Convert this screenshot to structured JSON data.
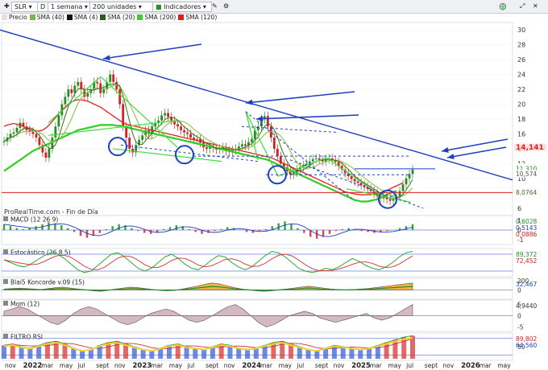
{
  "toolbar": {
    "symbol": "SLR",
    "timeframe_letter": "D",
    "period": "1 semana",
    "units": "200 unidades",
    "indicators": "Indicadores"
  },
  "legend": [
    {
      "label": "Precio",
      "color": "#e0e0e0"
    },
    {
      "label": "SMA (40)",
      "color": "#7ab648"
    },
    {
      "label": "SMA (4)",
      "color": "#111111"
    },
    {
      "label": "SMA (20)",
      "color": "#2e5e1a"
    },
    {
      "label": "SMA (200)",
      "color": "#3ecf2e"
    },
    {
      "label": "SMA (120)",
      "color": "#e02020"
    }
  ],
  "watermark": "ProRealTime.com - Fin de Día",
  "colors": {
    "price_up": "#2a8a2a",
    "price_down": "#cc2222",
    "sma4": "#1d1d1d",
    "sma20": "#3d6e1e",
    "sma40": "#8fbf3f",
    "sma120": "#e02020",
    "sma200": "#33cc22",
    "trend": "#1f3fbf"
  },
  "chart_data": [
    {
      "type": "line",
      "title": "SLR",
      "y_axis_ticks": [
        "30",
        "28",
        "26",
        "24",
        "22",
        "20",
        "18",
        "16",
        "14",
        "12",
        "10",
        "8",
        "6"
      ],
      "ylim": [
        5,
        31
      ],
      "x_axis_labels": [
        "nov",
        "2022",
        "mar",
        "may",
        "jul",
        "sept",
        "nov",
        "2023",
        "mar",
        "may",
        "jul",
        "sept",
        "nov",
        "2024",
        "mar",
        "may",
        "jul",
        "sept",
        "nov",
        "2025",
        "mar",
        "may",
        "jul",
        "sept",
        "nov",
        "2026",
        "mar",
        "may"
      ],
      "price_labels": [
        {
          "text": "14,141",
          "color": "#e02020"
        },
        {
          "text": "11,482",
          "color": "#999999"
        },
        {
          "text": "11,310",
          "color": "#2a8a2a"
        },
        {
          "text": "10,574",
          "color": "#555555"
        },
        {
          "text": "8,2716",
          "color": "#33cc22"
        },
        {
          "text": "8,0764",
          "color": "#3d6e1e"
        }
      ],
      "price_weekly": [
        15,
        15.5,
        16,
        16.2,
        16.8,
        17.5,
        17,
        16.5,
        16.3,
        16,
        15.5,
        14.5,
        13.5,
        12.8,
        14,
        15.5,
        17,
        18.5,
        20,
        21,
        22,
        21.5,
        22.5,
        23,
        22,
        21,
        21.5,
        22,
        23,
        22.8,
        21.5,
        22,
        23,
        24,
        23,
        22,
        20,
        17,
        15.5,
        14,
        13.5,
        14.5,
        15.2,
        15.8,
        16.5,
        16,
        17,
        17.5,
        17.8,
        18.5,
        18.8,
        18.3,
        17.8,
        17.3,
        17,
        16.5,
        16.2,
        16,
        15.5,
        15.2,
        15.3,
        14.8,
        14.2,
        14,
        14.3,
        14.1,
        13.9,
        14,
        14.2,
        13.7,
        13.6,
        13.8,
        14,
        14.3,
        14.6,
        14.4,
        14.9,
        15.3,
        16.5,
        17,
        18,
        18.4,
        17,
        15.5,
        14,
        13,
        12,
        11.5,
        11,
        10.5,
        10.8,
        11.2,
        11.5,
        11.8,
        12,
        12.3,
        12.6,
        12.7,
        12.5,
        12.3,
        12.6,
        12.7,
        12.4,
        12.2,
        11.7,
        11.2,
        10.7,
        10.3,
        9.9,
        9.6,
        9.4,
        9.1,
        8.9,
        8.6,
        8.3,
        8,
        7.6,
        7.3,
        7.5,
        7.2,
        7,
        7.2,
        7.6,
        8.3,
        9.2,
        10,
        10.6,
        11.2
      ],
      "sma120_weekly": [
        17,
        17.2,
        17.3,
        17.4,
        17.3,
        17.2,
        17,
        16.8,
        16.6,
        16.5,
        16.4,
        16.4,
        16.5,
        16.8,
        17.2,
        17.7,
        18.2,
        18.7,
        19.2,
        19.6,
        20,
        20.3,
        20.5,
        20.6,
        20.6,
        20.5,
        20.4,
        20.2,
        20,
        19.8,
        19.6,
        19.3,
        19,
        18.7,
        18.4,
        18.1,
        17.8,
        17.5,
        17.3,
        17.2,
        17.1,
        17,
        16.9,
        16.8,
        16.7,
        16.6,
        16.5,
        16.4,
        16.3,
        16.2,
        16.1,
        16,
        15.9,
        15.8,
        15.7,
        15.6,
        15.5,
        15.4,
        15.3,
        15.2,
        15.1,
        15,
        14.9,
        14.8,
        14.7,
        14.6,
        14.5,
        14.4,
        14.3,
        14.2,
        14.1,
        14,
        13.9,
        13.8,
        13.7,
        13.6,
        13.5,
        13.4,
        13.3,
        13.2,
        13.1,
        13,
        12.9,
        12.8,
        12.6,
        12.4,
        12.2,
        12,
        11.8,
        11.6,
        11.4,
        11.2,
        11,
        10.8,
        10.6,
        10.4,
        10.2,
        10,
        9.8,
        9.6,
        9.4,
        9.2,
        9,
        8.8,
        8.6,
        8.4,
        8.2,
        8.1,
        8,
        7.9,
        7.85,
        7.8,
        7.8,
        7.8,
        7.85,
        7.9,
        8,
        8.1,
        8.2,
        8.4,
        8.6,
        8.8,
        9,
        9.2,
        9.4
      ],
      "sma200_weekly": [
        11,
        11.3,
        11.6,
        11.9,
        12.2,
        12.5,
        12.8,
        13.1,
        13.4,
        13.7,
        13.9,
        14.1,
        14.3,
        14.5,
        14.7,
        14.9,
        15.1,
        15.3,
        15.5,
        15.7,
        15.9,
        16.1,
        16.3,
        16.5,
        16.6,
        16.7,
        16.8,
        16.9,
        17,
        17.1,
        17.2,
        17.2,
        17.2,
        17.2,
        17.2,
        17.1,
        17.1,
        17,
        16.9,
        16.8,
        16.7,
        16.6,
        16.5,
        16.4,
        16.3,
        16.2,
        16.1,
        16,
        15.9,
        15.8,
        15.7,
        15.6,
        15.5,
        15.4,
        15.3,
        15.2,
        15.1,
        15,
        14.9,
        14.8,
        14.7,
        14.6,
        14.5,
        14.4,
        14.3,
        14.2,
        14.1,
        14,
        13.9,
        13.8,
        13.7,
        13.6,
        13.5,
        13.4,
        13.3,
        13.2,
        13.1,
        13,
        12.9,
        12.8,
        12.7,
        12.6,
        12.5,
        12.3,
        12.1,
        11.9,
        11.7,
        11.5,
        11.3,
        11.1,
        10.9,
        10.7,
        10.5,
        10.3,
        10.1,
        9.9,
        9.7,
        9.5,
        9.3,
        9.1,
        8.9,
        8.7,
        8.5,
        8.3,
        8.1,
        7.9,
        7.7,
        7.5,
        7.3,
        7.1,
        7,
        6.9,
        6.9,
        6.9,
        7,
        7.1,
        7.2,
        7.4,
        7.6,
        7.8,
        8,
        8.2,
        8.3
      ]
    },
    {
      "type": "line",
      "title": "MACD (12 26 9)",
      "price_labels": [
        {
          "text": "0,6028",
          "color": "#2a8a2a"
        },
        {
          "text": "0,5143",
          "color": "#1f3fbf"
        },
        {
          "text": "0,0886",
          "color": "#cc2222"
        }
      ],
      "y_axis_ticks": [
        "1",
        "0",
        "-1"
      ],
      "ylim": [
        -1.5,
        1.5
      ],
      "values": [
        0.6,
        0.4,
        0.2,
        0.1,
        0.2,
        0.4,
        0.6,
        0.8,
        0.7,
        0.5,
        0.2,
        -0.2,
        -0.6,
        -0.8,
        -0.6,
        -0.3,
        0.1,
        0.4,
        0.6,
        0.5,
        0.2,
        -0.1,
        -0.3,
        -0.4,
        -0.2,
        0.1,
        0.3,
        0.5,
        0.4,
        0.1,
        -0.2,
        -0.4,
        -0.3,
        -0.1,
        0.1,
        0.3,
        0.2,
        0,
        -0.2,
        -0.3,
        -0.1,
        0.1,
        0.4,
        0.7,
        0.9,
        0.6,
        0.2,
        -0.3,
        -0.7,
        -0.9,
        -0.7,
        -0.4,
        -0.1,
        0.1,
        0.2,
        0.1,
        -0.1,
        -0.2,
        -0.3,
        -0.2,
        -0.1,
        0,
        0.2,
        0.4,
        0.6
      ]
    },
    {
      "type": "line",
      "title": "Estocástico (26 8 5)",
      "price_labels": [
        {
          "text": "89,372",
          "color": "#2a8a2a"
        },
        {
          "text": "72,452",
          "color": "#cc2222"
        }
      ],
      "ylim": [
        0,
        100
      ],
      "values": [
        60,
        50,
        40,
        35,
        45,
        60,
        75,
        85,
        80,
        65,
        45,
        25,
        15,
        20,
        40,
        60,
        80,
        85,
        70,
        50,
        30,
        20,
        30,
        50,
        70,
        80,
        65,
        45,
        30,
        25,
        40,
        60,
        75,
        70,
        50,
        35,
        25,
        35,
        55,
        75,
        90,
        85,
        70,
        50,
        30,
        20,
        15,
        20,
        30,
        25,
        35,
        50,
        65,
        55,
        40,
        30,
        25,
        35,
        50,
        70,
        85,
        90
      ]
    },
    {
      "type": "area",
      "title": "Blai5 Koncorde v.09 (15)",
      "price_labels": [
        {
          "text": "32,467",
          "color": "#1f3fbf"
        }
      ],
      "y_axis_ticks": [
        "200",
        "0"
      ],
      "ylim": [
        -200,
        250
      ],
      "values": [
        20,
        30,
        40,
        30,
        20,
        10,
        30,
        50,
        60,
        40,
        20,
        0,
        -20,
        -30,
        -10,
        20,
        40,
        60,
        50,
        30,
        10,
        -10,
        -20,
        -10,
        20,
        50,
        80,
        120,
        150,
        130,
        90,
        50,
        20,
        0,
        -20,
        -30,
        -20,
        0,
        20,
        40,
        60,
        80,
        60,
        40,
        20,
        10,
        0,
        10,
        20,
        30,
        50,
        70,
        90,
        110,
        130,
        150
      ]
    },
    {
      "type": "area",
      "title": "Mom (12)",
      "price_labels": [
        {
          "text": "4,9440",
          "color": "#333333"
        }
      ],
      "y_axis_ticks": [
        "5",
        "0",
        "-5"
      ],
      "ylim": [
        -7,
        7
      ],
      "values": [
        2,
        3,
        4,
        3,
        1,
        -1,
        -3,
        -4,
        -2,
        1,
        3,
        4,
        3,
        1,
        -1,
        -3,
        -4,
        -3,
        -1,
        1,
        2,
        3,
        2,
        0,
        -2,
        -3,
        -2,
        0,
        2,
        4,
        5,
        3,
        0,
        -3,
        -5,
        -4,
        -2,
        0,
        1,
        2,
        1,
        -1,
        -2,
        -3,
        -2,
        -1,
        0,
        1,
        -1,
        -2,
        -1,
        1,
        3,
        5
      ]
    },
    {
      "type": "line",
      "title": "FILTRO RSI",
      "price_labels": [
        {
          "text": "89,802",
          "color": "#cc2222"
        },
        {
          "text": "64,560",
          "color": "#1f3fbf"
        }
      ],
      "y_axis_ticks": [
        "50"
      ],
      "ylim": [
        0,
        100
      ],
      "values": [
        55,
        60,
        50,
        45,
        55,
        65,
        70,
        60,
        45,
        35,
        40,
        55,
        65,
        70,
        60,
        50,
        40,
        35,
        45,
        55,
        60,
        50,
        45,
        40,
        50,
        60,
        55,
        45,
        40,
        45,
        55,
        65,
        70,
        60,
        50,
        40,
        35,
        45,
        55,
        50,
        45,
        40,
        45,
        55,
        65,
        75,
        85,
        90
      ]
    }
  ]
}
